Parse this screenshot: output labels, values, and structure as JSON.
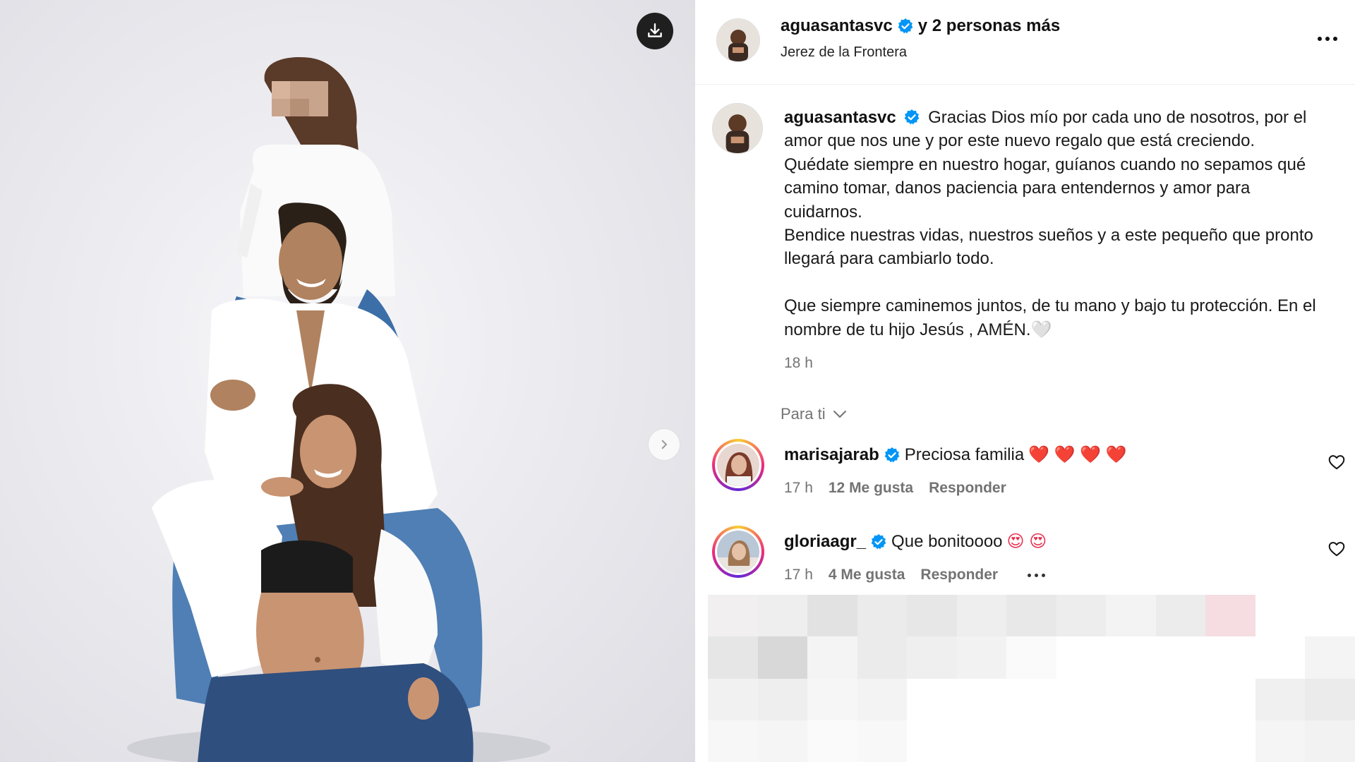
{
  "photo": {
    "download_label": "download",
    "next_label": "next"
  },
  "header": {
    "username": "aguasantasvc",
    "others": "y 2 personas más",
    "location": "Jerez de la Frontera"
  },
  "caption": {
    "username": "aguasantasvc",
    "text_p1": "Gracias Dios mío por cada uno de nosotros, por el amor que nos une y por este nuevo regalo que está creciendo. Quédate siempre en nuestro hogar, guíanos cuando no sepamos qué camino tomar, danos paciencia para entendernos y amor para cuidarnos.",
    "text_p2": "Bendice nuestras vidas, nuestros sueños y a este pequeño que pronto llegará para cambiarlo todo.",
    "text_p3": "Que siempre caminemos juntos, de tu mano y bajo tu protección. En el nombre de tu hijo Jesús , AMÉN.",
    "emoji": "🤍",
    "time": "18 h"
  },
  "para_ti": "Para ti",
  "comments": [
    {
      "username": "marisajarab",
      "text": "Preciosa familia",
      "emoji": "❤️ ❤️ ❤️ ❤️",
      "time": "17 h",
      "likes": "12 Me gusta",
      "reply": "Responder"
    },
    {
      "username": "gloriaagr_",
      "text": "Que bonitoooo",
      "emoji": "😍 😍",
      "time": "17 h",
      "likes": "4 Me gusta",
      "reply": "Responder"
    }
  ],
  "colors": {
    "verified": "#0095f6",
    "secondary_text": "#737373",
    "download_bg": "#1f1f1f"
  },
  "icons": {
    "download": "download-icon",
    "next": "chevron-right-icon",
    "more": "more-horizontal-icon",
    "verified": "verified-badge-icon",
    "heart": "heart-outline-icon",
    "chevron": "chevron-down-icon"
  }
}
